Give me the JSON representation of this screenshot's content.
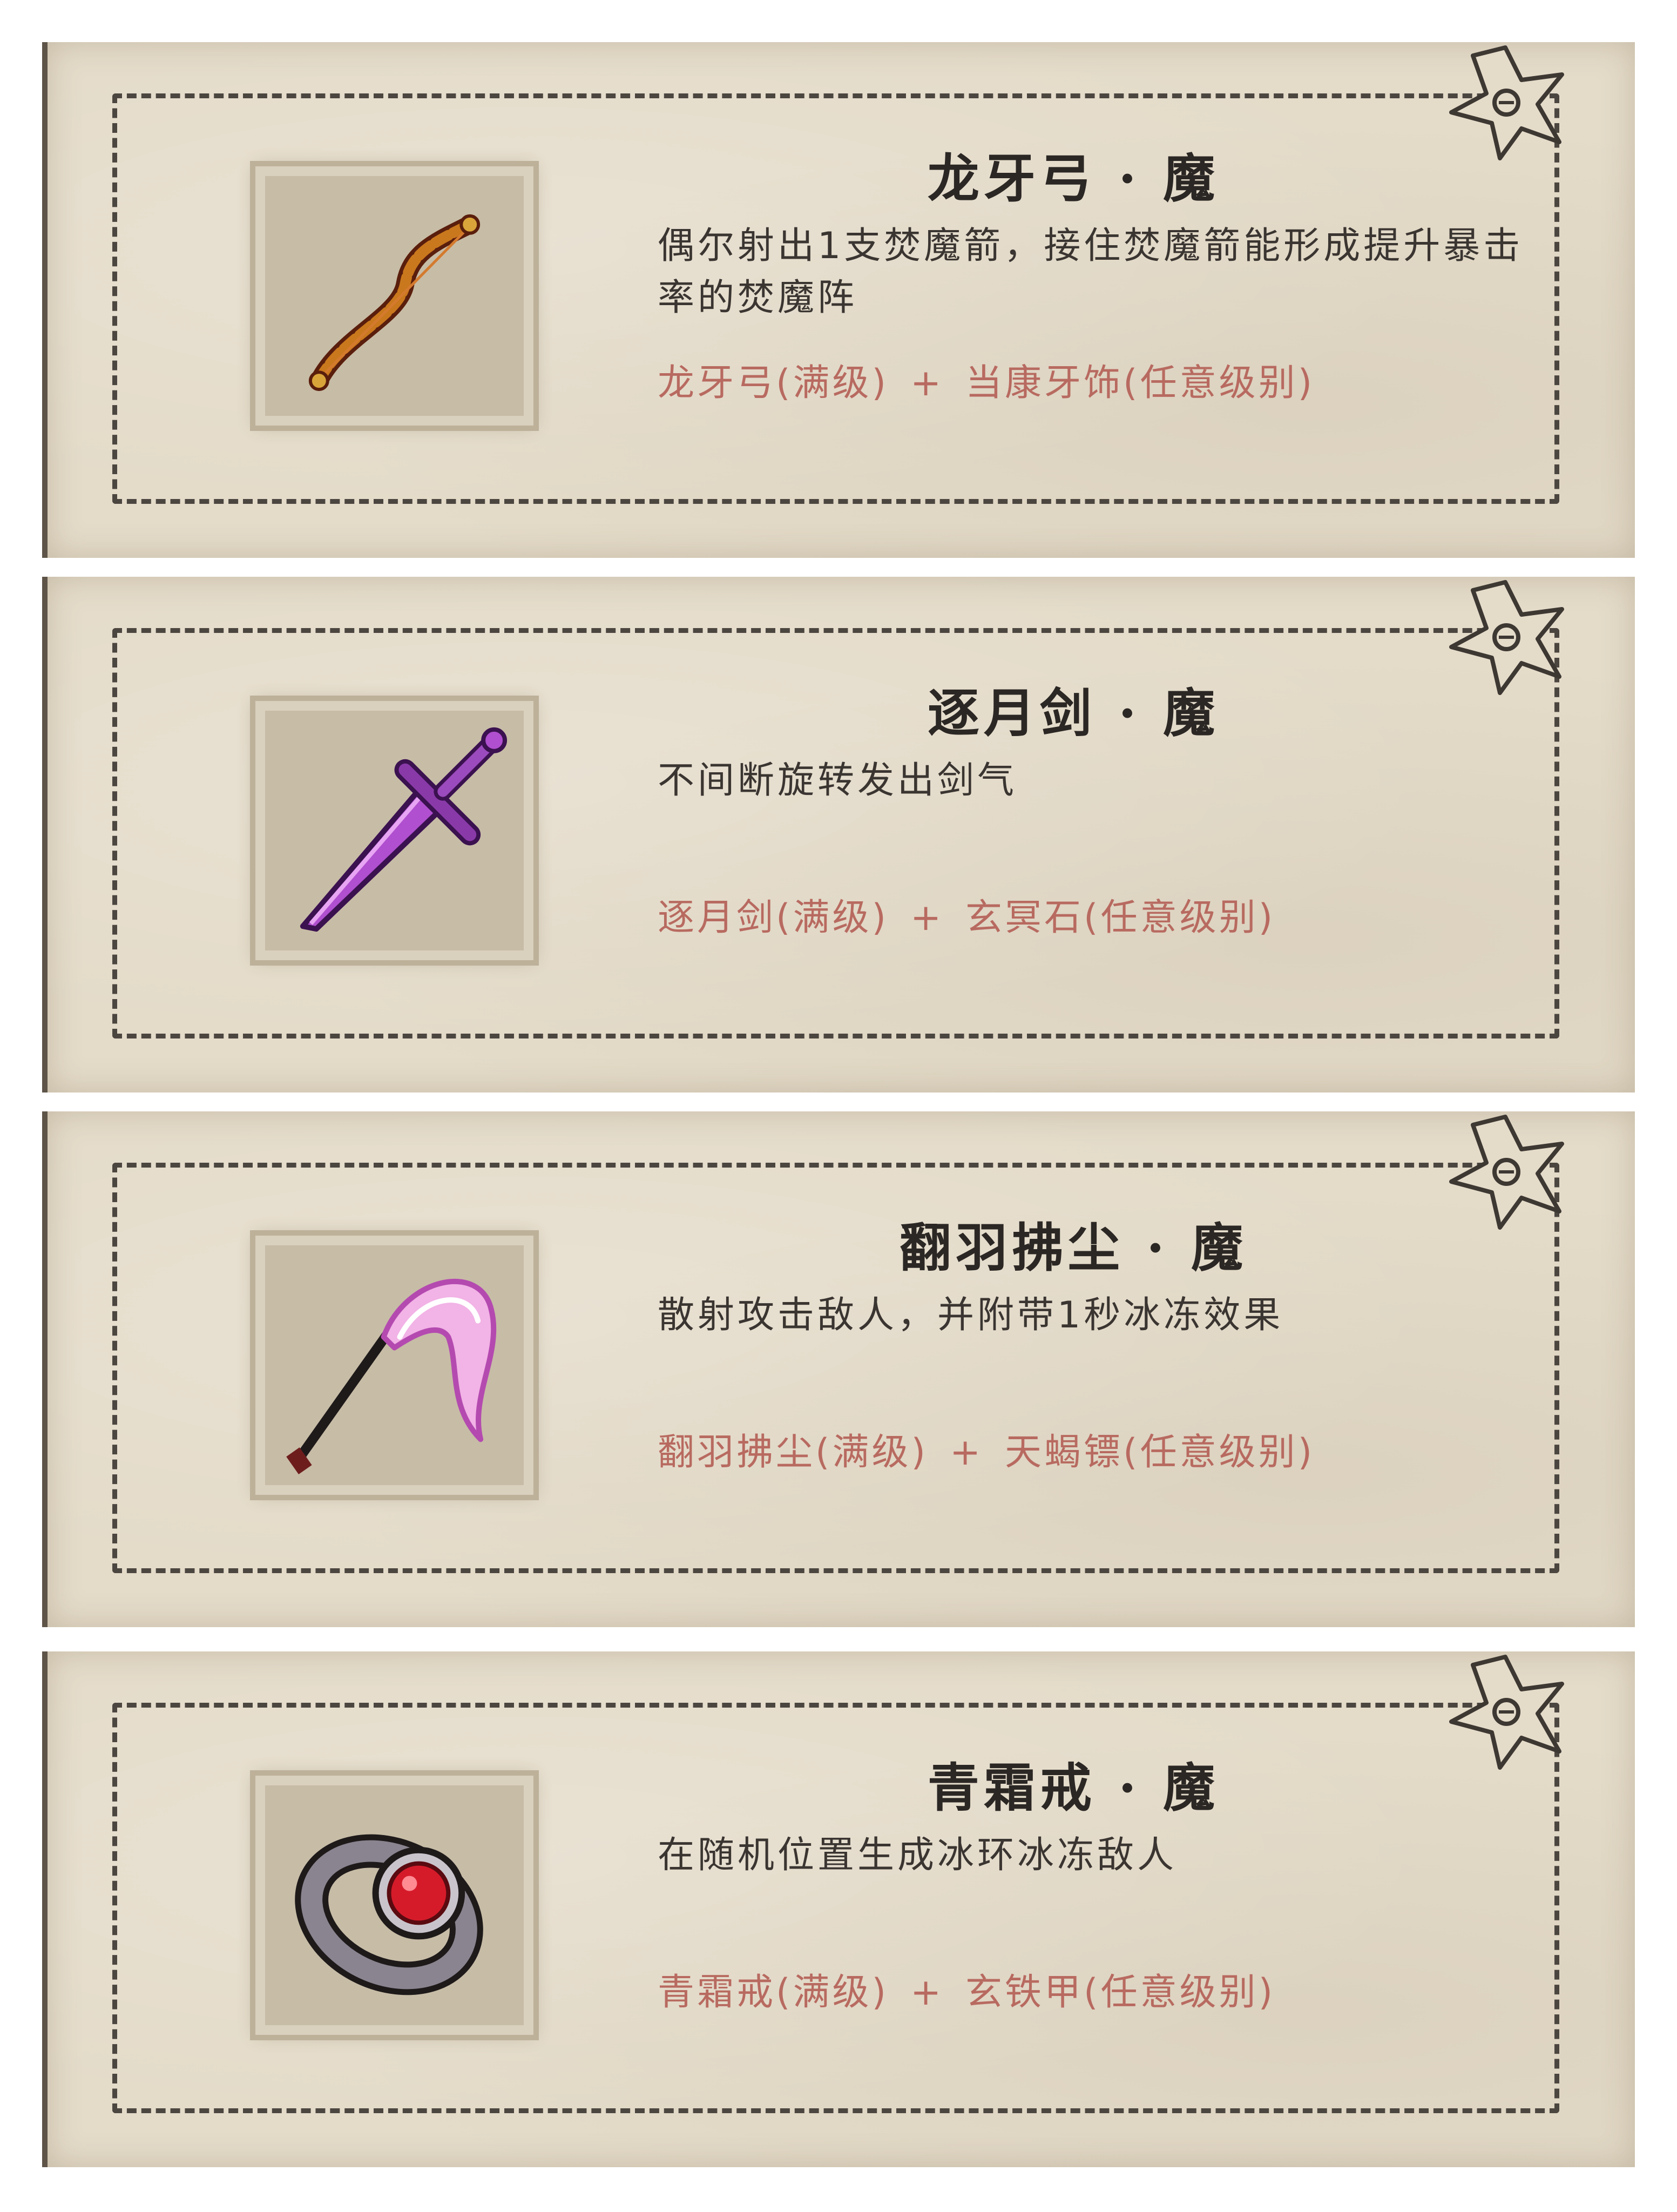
{
  "cards": [
    {
      "title": "龙牙弓 · 魔",
      "description": "偶尔射出1支焚魔箭，接住焚魔箭能形成提升暴击率的焚魔阵",
      "recipe_a": "龙牙弓(满级)",
      "plus": "+",
      "recipe_b": "当康牙饰(任意级别)",
      "icon": "bow-icon"
    },
    {
      "title": "逐月剑 · 魔",
      "description": "不间断旋转发出剑气",
      "recipe_a": "逐月剑(满级)",
      "plus": "+",
      "recipe_b": "玄冥石(任意级别)",
      "icon": "sword-icon"
    },
    {
      "title": "翻羽拂尘 · 魔",
      "description": "散射攻击敌人，并附带1秒冰冻效果",
      "recipe_a": "翻羽拂尘(满级)",
      "plus": "+",
      "recipe_b": "天蝎镖(任意级别)",
      "icon": "whisk-icon"
    },
    {
      "title": "青霜戒 · 魔",
      "description": "在随机位置生成冰环冰冻敌人",
      "recipe_a": "青霜戒(满级)",
      "plus": "+",
      "recipe_b": "玄铁甲(任意级别)",
      "icon": "ring-icon"
    }
  ],
  "colors": {
    "card_bg": "#e4dbc9",
    "title": "#2b2724",
    "description": "#3a3531",
    "recipe": "#b86a60"
  }
}
